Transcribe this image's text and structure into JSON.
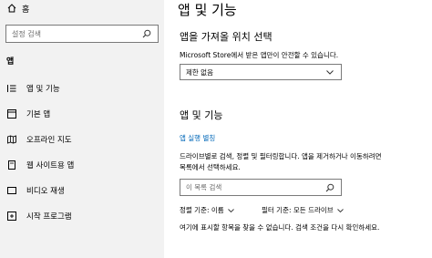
{
  "sidebar": {
    "home_label": "홈",
    "search_placeholder": "설정 검색",
    "section_label": "앱",
    "items": [
      {
        "label": "앱 및 기능",
        "icon": "list-icon"
      },
      {
        "label": "기본 앱",
        "icon": "default-apps-icon"
      },
      {
        "label": "오프라인 지도",
        "icon": "map-icon"
      },
      {
        "label": "웹 사이트용 앱",
        "icon": "website-apps-icon"
      },
      {
        "label": "비디오 재생",
        "icon": "video-icon"
      },
      {
        "label": "시작 프로그램",
        "icon": "startup-icon"
      }
    ]
  },
  "main": {
    "page_title": "앱 및 기능",
    "install_heading": "앱을 가져올 위치 선택",
    "install_desc": "Microsoft Store에서 받은 앱만이 안전할 수 있습니다.",
    "install_dropdown_value": "제한 없음",
    "apps_heading": "앱 및 기능",
    "aliases_link": "앱 실행 별칭",
    "apps_desc_line1": "드라이브별로 검색, 정렬 및 필터링합니다. 앱을 제거하거나 이동하려면",
    "apps_desc_line2": "목록에서 선택하세요.",
    "list_search_placeholder": "이 목록 검색",
    "sort_label": "정렬 기준: 이름",
    "filter_label": "필터 기준: 모든 드라이브",
    "empty_message": "여기에 표시할 항목을 찾을 수 없습니다. 검색 조건을 다시 확인하세요."
  }
}
